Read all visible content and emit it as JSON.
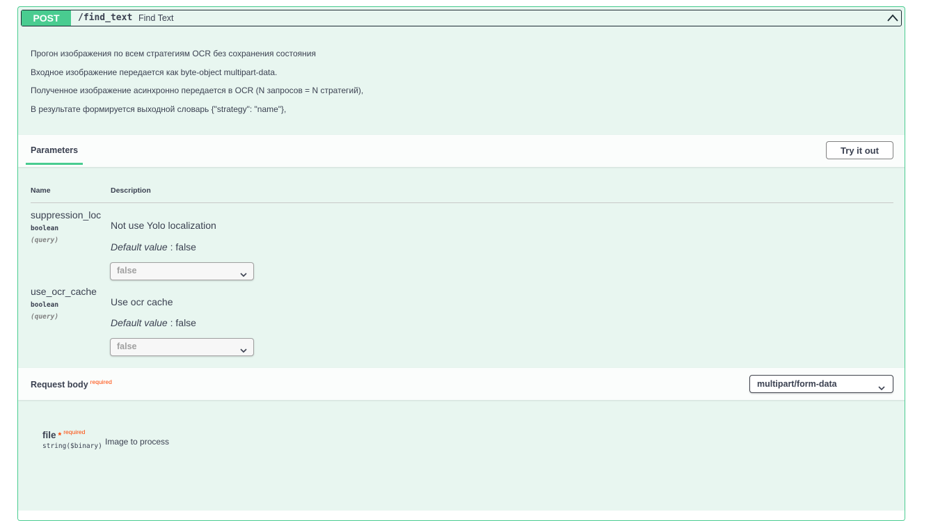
{
  "summary": {
    "method": "POST",
    "path": "/find_text",
    "description": "Find Text",
    "collapse_icon": "chevron-up-icon"
  },
  "description_lines": [
    "Прогон изображения по всем стратегиям OCR без сохранения состояния",
    "Входное изображение передается как byte-object multipart-data.",
    "Полученное изображение асинхронно передается в OCR (N запросов = N стратегий),",
    "В результате формируется выходной словарь {\"strategy\": \"name\"},"
  ],
  "parameters": {
    "tab_label": "Parameters",
    "try_button": "Try it out",
    "columns": {
      "name": "Name",
      "description": "Description"
    },
    "items": [
      {
        "name": "suppression_loc",
        "type": "boolean",
        "in": "(query)",
        "description": "Not use Yolo localization",
        "default_label": "Default value",
        "default_sep": " : false",
        "selected": "false"
      },
      {
        "name": "use_ocr_cache",
        "type": "boolean",
        "in": "(query)",
        "description": "Use ocr cache",
        "default_label": "Default value",
        "default_sep": " : false",
        "selected": "false"
      }
    ]
  },
  "request_body": {
    "title": "Request body",
    "required_label": "required",
    "content_type": "multipart/form-data",
    "field": {
      "name": "file",
      "star": "*",
      "required_label": "required",
      "type": "string($binary)",
      "description": "Image to process"
    }
  },
  "colors": {
    "accent": "#49cc90",
    "background": "#e8f6f0",
    "required": "#ff4500"
  }
}
